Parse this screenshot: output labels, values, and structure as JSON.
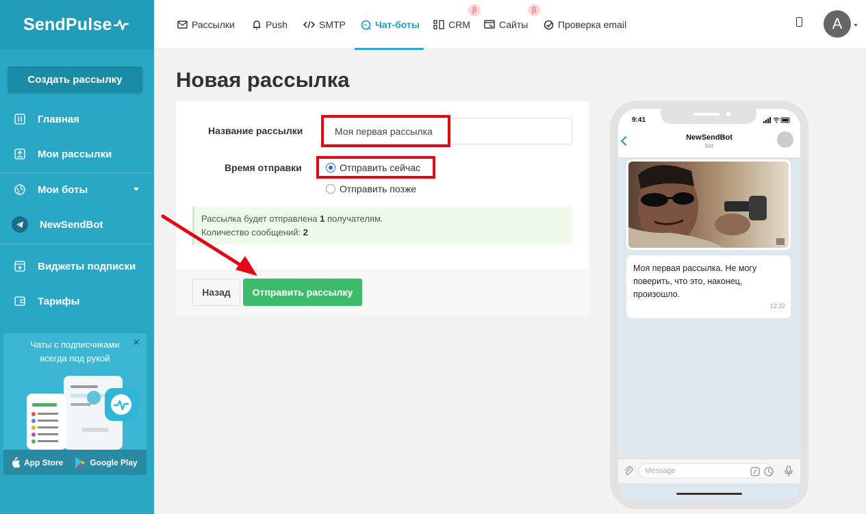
{
  "app": {
    "logo": "SendPulse"
  },
  "sidebar": {
    "create_button": "Создать рассылку",
    "items": [
      {
        "label": "Главная",
        "icon": "home-icon"
      },
      {
        "label": "Мои рассылки",
        "icon": "mailings-icon"
      },
      {
        "label": "Мои боты",
        "icon": "globe-icon"
      },
      {
        "label": "NewSendBot",
        "icon": "telegram-icon"
      },
      {
        "label": "Виджеты подписки",
        "icon": "widget-icon"
      },
      {
        "label": "Тарифы",
        "icon": "wallet-icon"
      }
    ],
    "promo": {
      "text_line1": "Чаты с подписчиками",
      "text_line2": "всегда под рукой",
      "close": "✕",
      "app_store": "App Store",
      "google_play": "Google Play"
    }
  },
  "topnav": {
    "items": [
      {
        "label": "Рассылки",
        "icon": "mail-icon"
      },
      {
        "label": "Push",
        "icon": "bell-icon"
      },
      {
        "label": "SMTP",
        "icon": "code-icon"
      },
      {
        "label": "Чат-боты",
        "icon": "chat-icon",
        "active": true
      },
      {
        "label": "CRM",
        "icon": "crm-icon",
        "beta": true
      },
      {
        "label": "Сайты",
        "icon": "site-icon",
        "beta": true
      },
      {
        "label": "Проверка email",
        "icon": "check-icon"
      }
    ],
    "beta_mark": "β",
    "user_initial": "A"
  },
  "page": {
    "title": "Новая рассылка",
    "form": {
      "name_label": "Название рассылки",
      "name_value": "Моя первая рассылка",
      "time_label": "Время отправки",
      "option_now": "Отправить сейчас",
      "option_later": "Отправить позже",
      "info_line1_prefix": "Рассылка будет отправлена ",
      "info_recipients": "1",
      "info_line1_suffix": " получателям.",
      "info_line2_prefix": "Количество сообщений: ",
      "info_messages": "2"
    },
    "buttons": {
      "back": "Назад",
      "send": "Отправить рассылку"
    }
  },
  "phone": {
    "time": "9:41",
    "bot_name": "NewSendBot",
    "bot_sub": "bot",
    "message_text": "Моя первая рассылка. Не могу поверить, что это, наконец, произошло.",
    "message_time": "12:32",
    "input_placeholder": "Message"
  },
  "colors": {
    "sidebar": "#2aa7c4",
    "accent": "#1aa0bf",
    "send_button": "#3dbd6b",
    "highlight": "#e30613"
  }
}
